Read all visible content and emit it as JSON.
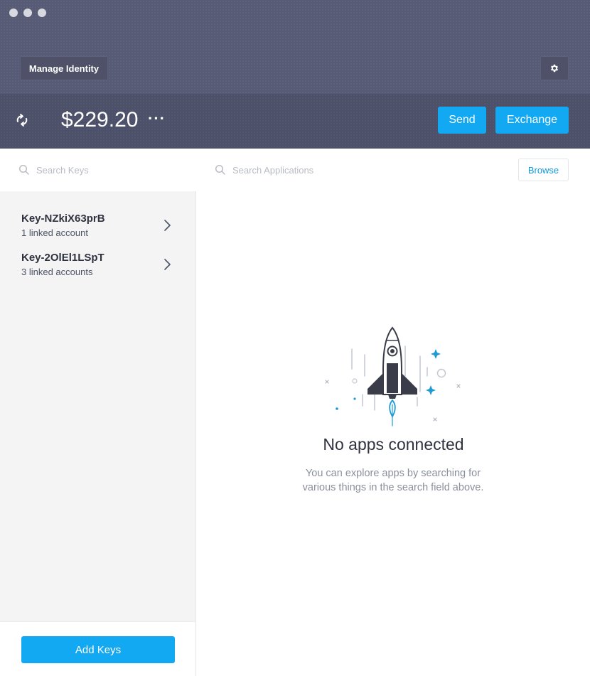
{
  "header": {
    "manage_identity_label": "Manage Identity",
    "balance": "$229.20",
    "more_label": "···",
    "send_label": "Send",
    "exchange_label": "Exchange"
  },
  "sidebar": {
    "search_placeholder": "Search Keys",
    "keys": [
      {
        "name": "Key-NZkiX63prB",
        "linked": "1 linked account"
      },
      {
        "name": "Key-2OlEl1LSpT",
        "linked": "3 linked accounts"
      }
    ],
    "add_keys_label": "Add Keys"
  },
  "main": {
    "search_placeholder": "Search Applications",
    "browse_label": "Browse",
    "empty_title": "No apps connected",
    "empty_description": "You can explore apps by searching for various things in the search field above."
  },
  "colors": {
    "accent": "#13a9f2",
    "header_bg": "#50536d"
  },
  "icons": [
    "sync-icon",
    "gear-icon",
    "search-icon",
    "chevron-right-icon",
    "rocket-illustration"
  ]
}
